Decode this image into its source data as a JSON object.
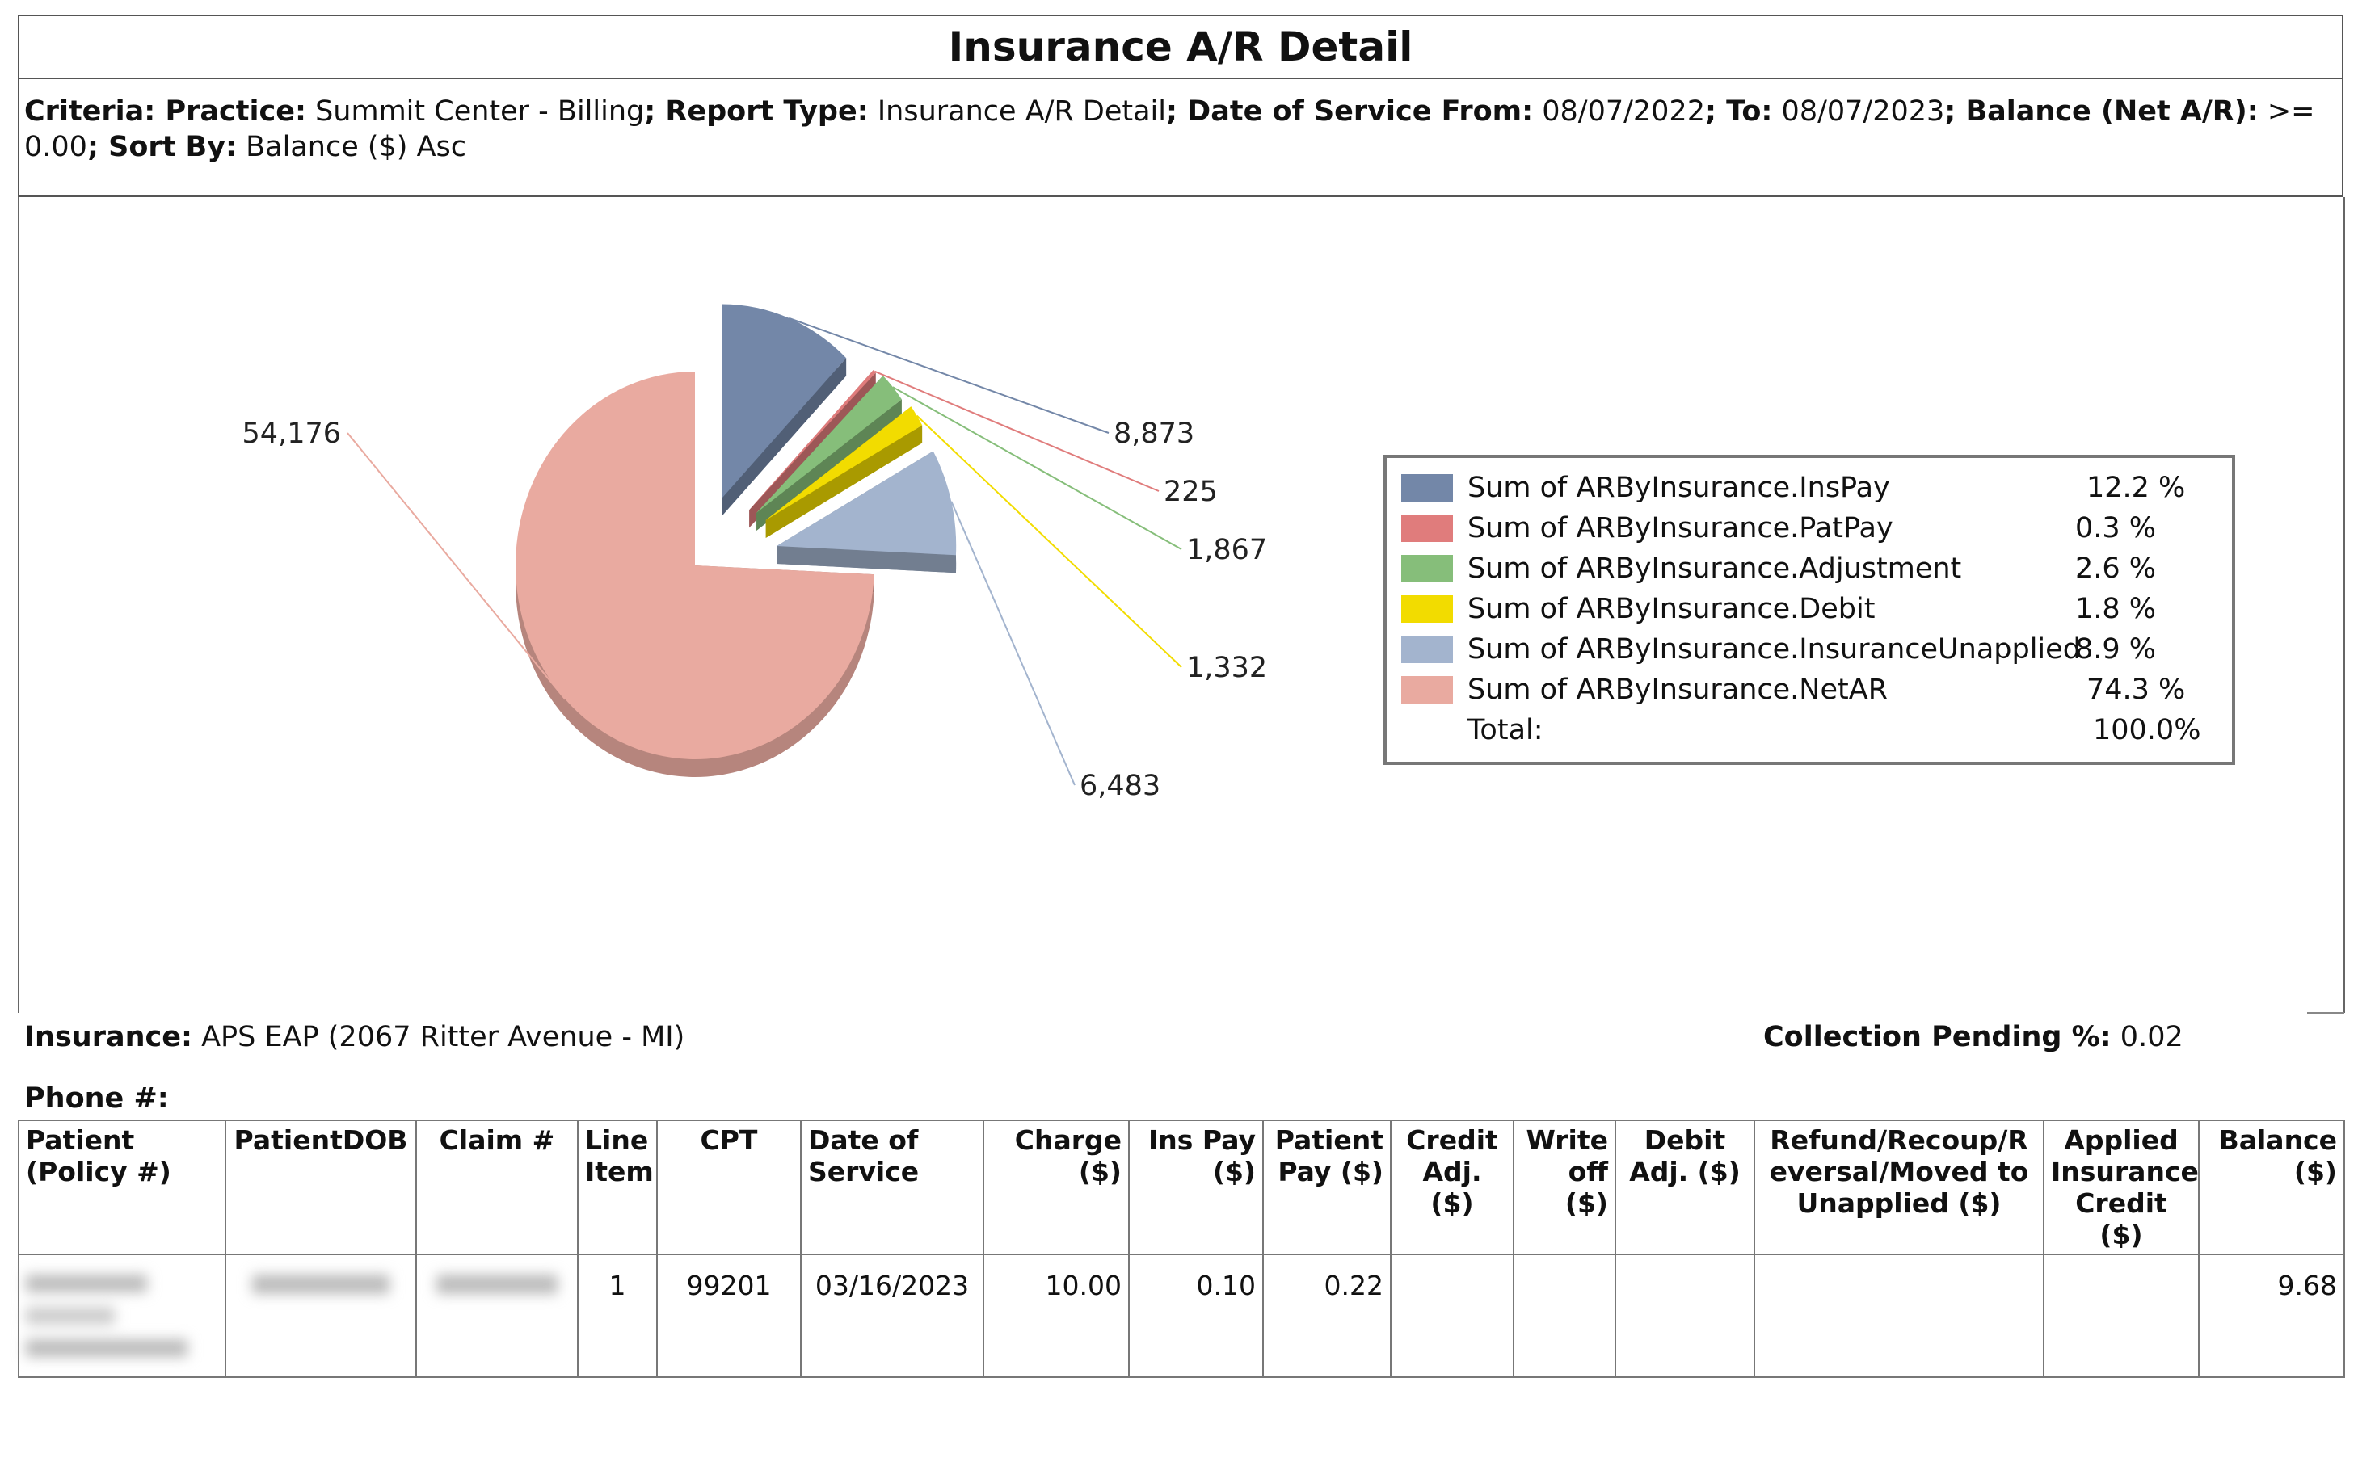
{
  "report": {
    "title": "Insurance A/R Detail",
    "criteria": [
      {
        "label": "Criteria: Practice:",
        "value": " Summit Center - Billing"
      },
      {
        "label": "; Report Type:",
        "value": " Insurance A/R Detail"
      },
      {
        "label": "; Date of Service From:",
        "value": " 08/07/2022"
      },
      {
        "label": "; To:",
        "value": " 08/07/2023"
      },
      {
        "label": "; Balance (Net A/R):",
        "value": " >= 0.00"
      },
      {
        "label": "; Sort By:",
        "value": " Balance ($) Asc"
      }
    ]
  },
  "chart_data": {
    "type": "pie",
    "title": "",
    "slices": [
      {
        "label": "Sum of ARByInsurance.InsPay",
        "value": 8873,
        "value_label": "8,873",
        "percent": "12.2 %",
        "color": "#7387A8"
      },
      {
        "label": "Sum of ARByInsurance.PatPay",
        "value": 225,
        "value_label": "225",
        "percent": "0.3 %",
        "color": "#E07C7C"
      },
      {
        "label": "Sum of ARByInsurance.Adjustment",
        "value": 1867,
        "value_label": "1,867",
        "percent": "2.6 %",
        "color": "#86BE7A"
      },
      {
        "label": "Sum of ARByInsurance.Debit",
        "value": 1332,
        "value_label": "1,332",
        "percent": "1.8 %",
        "color": "#F2DC00"
      },
      {
        "label": "Sum of ARByInsurance.InsuranceUnapplied",
        "value": 6483,
        "value_label": "6,483",
        "percent": "8.9 %",
        "color": "#A3B4CE"
      },
      {
        "label": "Sum of ARByInsurance.NetAR",
        "value": 54176,
        "value_label": "54,176",
        "percent": "74.3 %",
        "color": "#E9AAA0"
      }
    ],
    "total_label": "Total:",
    "total_percent": "100.0%",
    "legend_position": "right"
  },
  "insurance": {
    "label": "Insurance:",
    "value": " APS EAP (2067 Ritter Avenue - MI)",
    "phone_label": "Phone #:",
    "collection_label": "Collection Pending %:",
    "collection_value": " 0.02"
  },
  "table": {
    "headers": [
      "Patient (Policy #)",
      "PatientDOB",
      "Claim #",
      "Line Item",
      "CPT",
      "Date of Service",
      "Charge ($)",
      "Ins Pay ($)",
      "Patient Pay ($)",
      "Credit Adj. ($)",
      "Write off ($)",
      "Debit Adj. ($)",
      "Refund/Recoup/Reversal/Moved to Unapplied ($)",
      "Applied Insurance Credit ($)",
      "Balance ($)"
    ],
    "rows": [
      [
        "",
        "",
        "",
        "1",
        "99201",
        "03/16/2023",
        "10.00",
        "0.10",
        "0.22",
        "",
        "",
        "",
        "",
        "",
        "9.68"
      ]
    ]
  }
}
